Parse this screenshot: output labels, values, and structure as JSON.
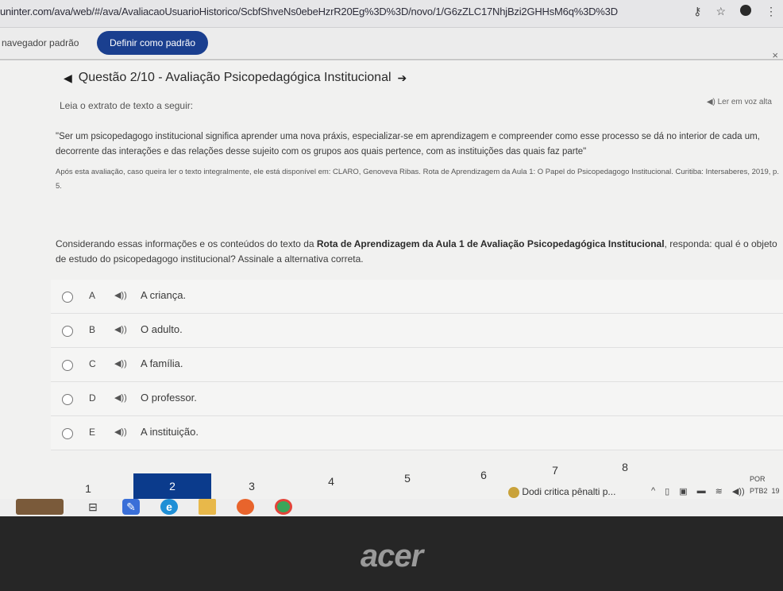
{
  "browser": {
    "url": "uninter.com/ava/web/#/ava/AvaliacaoUsuarioHistorico/ScbfShveNs0ebeHzrR20Eg%3D%3D/novo/1/G6zZLC17NhjBzi2GHHsM6q%3D%3D"
  },
  "infobar": {
    "text": "navegador padrão",
    "button_label": "Definir como padrão",
    "close": "×"
  },
  "question": {
    "title": "Questão 2/10 - Avaliação Psicopedagógica Institucional",
    "instruction": "Leia o extrato de texto a seguir:",
    "read_aloud": "Ler em voz alta",
    "quote": "\"Ser um psicopedagogo institucional significa aprender uma nova práxis, especializar-se em aprendizagem e compreender como esse processo se dá no interior de cada um, decorrente das interações e das relações desse sujeito com os grupos aos quais pertence, com as instituições das quais faz parte\"",
    "credit": "Após esta avaliação, caso queira ler o texto integralmente, ele está disponível em: CLARO, Genoveva Ribas. Rota de Aprendizagem da Aula 1: O Papel do Psicopedagogo Institucional. Curitiba: Intersaberes, 2019, p. 5.",
    "prompt_start": "Considerando essas informações e os conteúdos do texto da ",
    "prompt_bold": "Rota de Aprendizagem da Aula 1 de Avaliação Psicopedagógica Institucional",
    "prompt_end": ", responda: qual é o objeto de estudo do psicopedagogo institucional? Assinale a alternativa correta."
  },
  "options": [
    {
      "letter": "A",
      "text": "A criança."
    },
    {
      "letter": "B",
      "text": "O adulto."
    },
    {
      "letter": "C",
      "text": "A família."
    },
    {
      "letter": "D",
      "text": "O professor."
    },
    {
      "letter": "E",
      "text": "A instituição."
    }
  ],
  "pagination": {
    "pages": [
      "1",
      "2",
      "3",
      "4",
      "5",
      "6",
      "7",
      "8"
    ],
    "active": "2"
  },
  "taskbar": {
    "news": "Dodi critica pênalti p...",
    "lang": "POR",
    "layout": "PTB2",
    "time": "19"
  },
  "laptop": {
    "brand": "acer"
  },
  "colors": {
    "accent": "#0b3b8c",
    "button": "#1a3f8f"
  }
}
